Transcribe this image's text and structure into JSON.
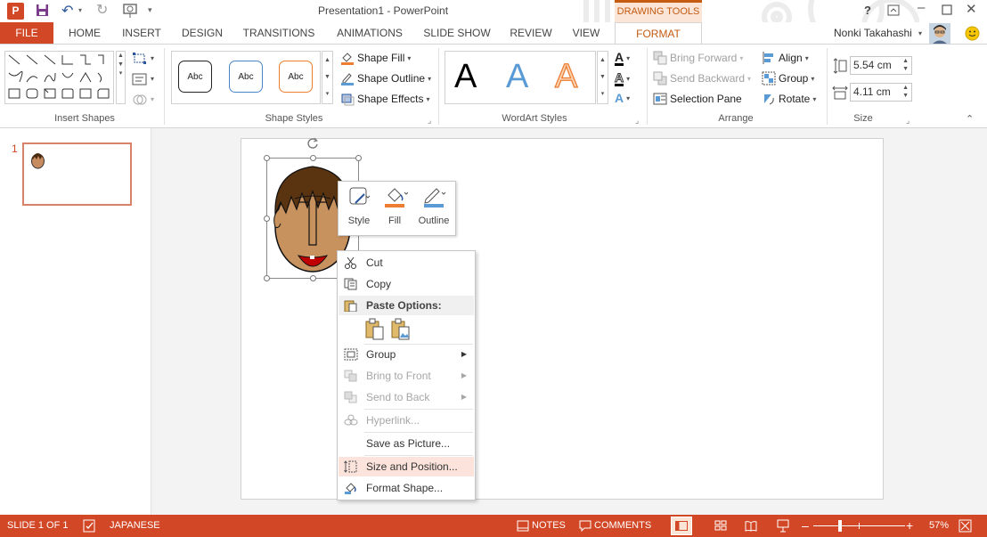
{
  "titlebar": {
    "title": "Presentation1 - PowerPoint",
    "drawing_tools": "DRAWING TOOLS",
    "help": "?",
    "colors": {
      "accent": "#d24726",
      "format": "#c55a11"
    }
  },
  "tabs": [
    "FILE",
    "HOME",
    "INSERT",
    "DESIGN",
    "TRANSITIONS",
    "ANIMATIONS",
    "SLIDE SHOW",
    "REVIEW",
    "VIEW",
    "FORMAT"
  ],
  "user": {
    "name": "Nonki Takahashi"
  },
  "ribbon": {
    "insert_shapes": {
      "label": "Insert Shapes"
    },
    "shape_styles": {
      "label": "Shape Styles",
      "samples": [
        "Abc",
        "Abc",
        "Abc"
      ],
      "fill": "Shape Fill",
      "outline": "Shape Outline",
      "effects": "Shape Effects"
    },
    "wordart": {
      "label": "WordArt Styles",
      "samples": [
        "A",
        "A",
        "A"
      ]
    },
    "arrange": {
      "label": "Arrange",
      "bring_forward": "Bring Forward",
      "send_backward": "Send Backward",
      "selection_pane": "Selection Pane",
      "align": "Align",
      "group": "Group",
      "rotate": "Rotate"
    },
    "size": {
      "label": "Size",
      "height": "5.54 cm",
      "width": "4.11 cm"
    }
  },
  "slide_panel": {
    "slide_number": "1"
  },
  "mini_toolbar": {
    "style": "Style",
    "fill": "Fill",
    "outline": "Outline"
  },
  "context_menu": {
    "cut": "Cut",
    "copy": "Copy",
    "paste_options": "Paste Options:",
    "group": "Group",
    "bring_to_front": "Bring to Front",
    "send_to_back": "Send to Back",
    "hyperlink": "Hyperlink...",
    "save_as_picture": "Save as Picture...",
    "size_and_position": "Size and Position...",
    "format_shape": "Format Shape..."
  },
  "statusbar": {
    "slide_info": "SLIDE 1 OF 1",
    "language": "JAPANESE",
    "notes": "NOTES",
    "comments": "COMMENTS",
    "zoom": "57%"
  }
}
